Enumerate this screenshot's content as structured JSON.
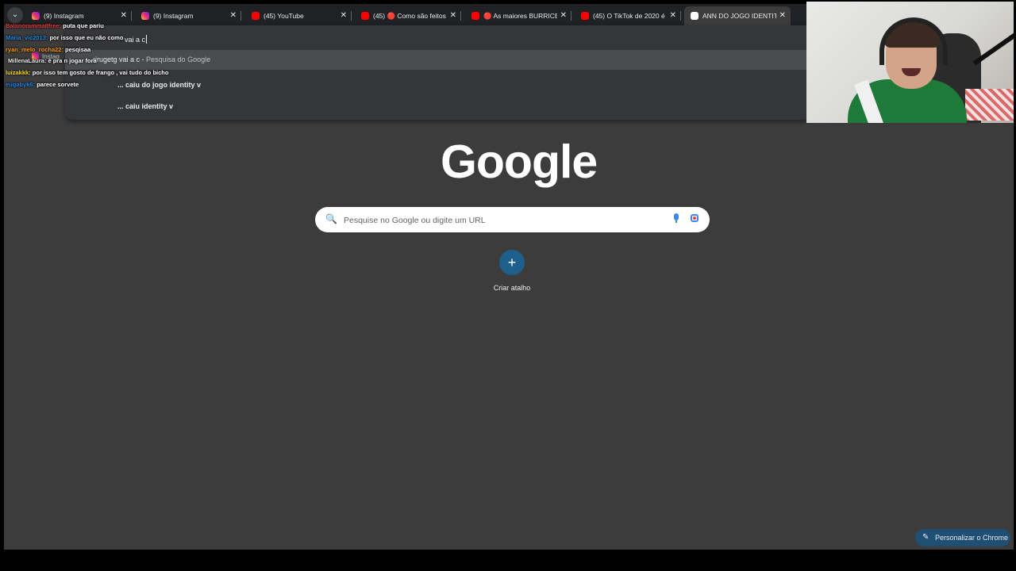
{
  "tabs": [
    {
      "title": "(9) Instagram",
      "favicon": "instagram-icon",
      "active": false
    },
    {
      "title": "(9) Instagram",
      "favicon": "instagram-icon",
      "active": false
    },
    {
      "title": "(45) YouTube",
      "favicon": "youtube-icon",
      "active": false
    },
    {
      "title": "(45) 🔴 Como são feitos os",
      "favicon": "youtube-icon",
      "active": false
    },
    {
      "title": "🔴 As maiores BURRICES",
      "favicon": "youtube-icon",
      "active": false
    },
    {
      "title": "(45) O TikTok de 2020 é R",
      "favicon": "youtube-icon",
      "active": false
    },
    {
      "title": "ANN DO JOGO IDENTITY",
      "favicon": "google-icon",
      "active": true
    }
  ],
  "omnibox": {
    "typed": "vai a c",
    "suggestion_highlight": {
      "query": "rirugetg vai a c",
      "desc": "Pesquisa do Google"
    },
    "suggestions": [
      "... caiu do jogo identity v",
      "... caiu identity v"
    ]
  },
  "ntp": {
    "logo": "Google",
    "search_placeholder": "Pesquise no Google ou digite um URL",
    "shortcut_label": "Criar atalho",
    "customize_label": "Personalizar o Chrome"
  },
  "chat": [
    {
      "user": "Balanoramma8free:",
      "text": "puta que pariu",
      "color": "#e53935"
    },
    {
      "user": "Maria_vic2013:",
      "text": "por isso que eu não como",
      "color": "#1e88e5"
    },
    {
      "user": "ryan_melo_rocha22:",
      "text": "pesqisaa",
      "color": "#ff9800"
    },
    {
      "user": "MillenaLaura:",
      "text": "é pra n jogar fora",
      "color": "#e8eaed"
    },
    {
      "user": "luizakkk:",
      "text": "por isso tem gosto de frango , vai tudo do bicho",
      "color": "#fdd835"
    },
    {
      "user": "eugabyk6:",
      "text": "parece sorvete",
      "color": "#1e88e5"
    }
  ],
  "overlap_tab_label": "Instag",
  "colors": {
    "tab_strip": "#202124",
    "page_bg": "#3c3c3c",
    "accent": "#1f5f8b"
  }
}
